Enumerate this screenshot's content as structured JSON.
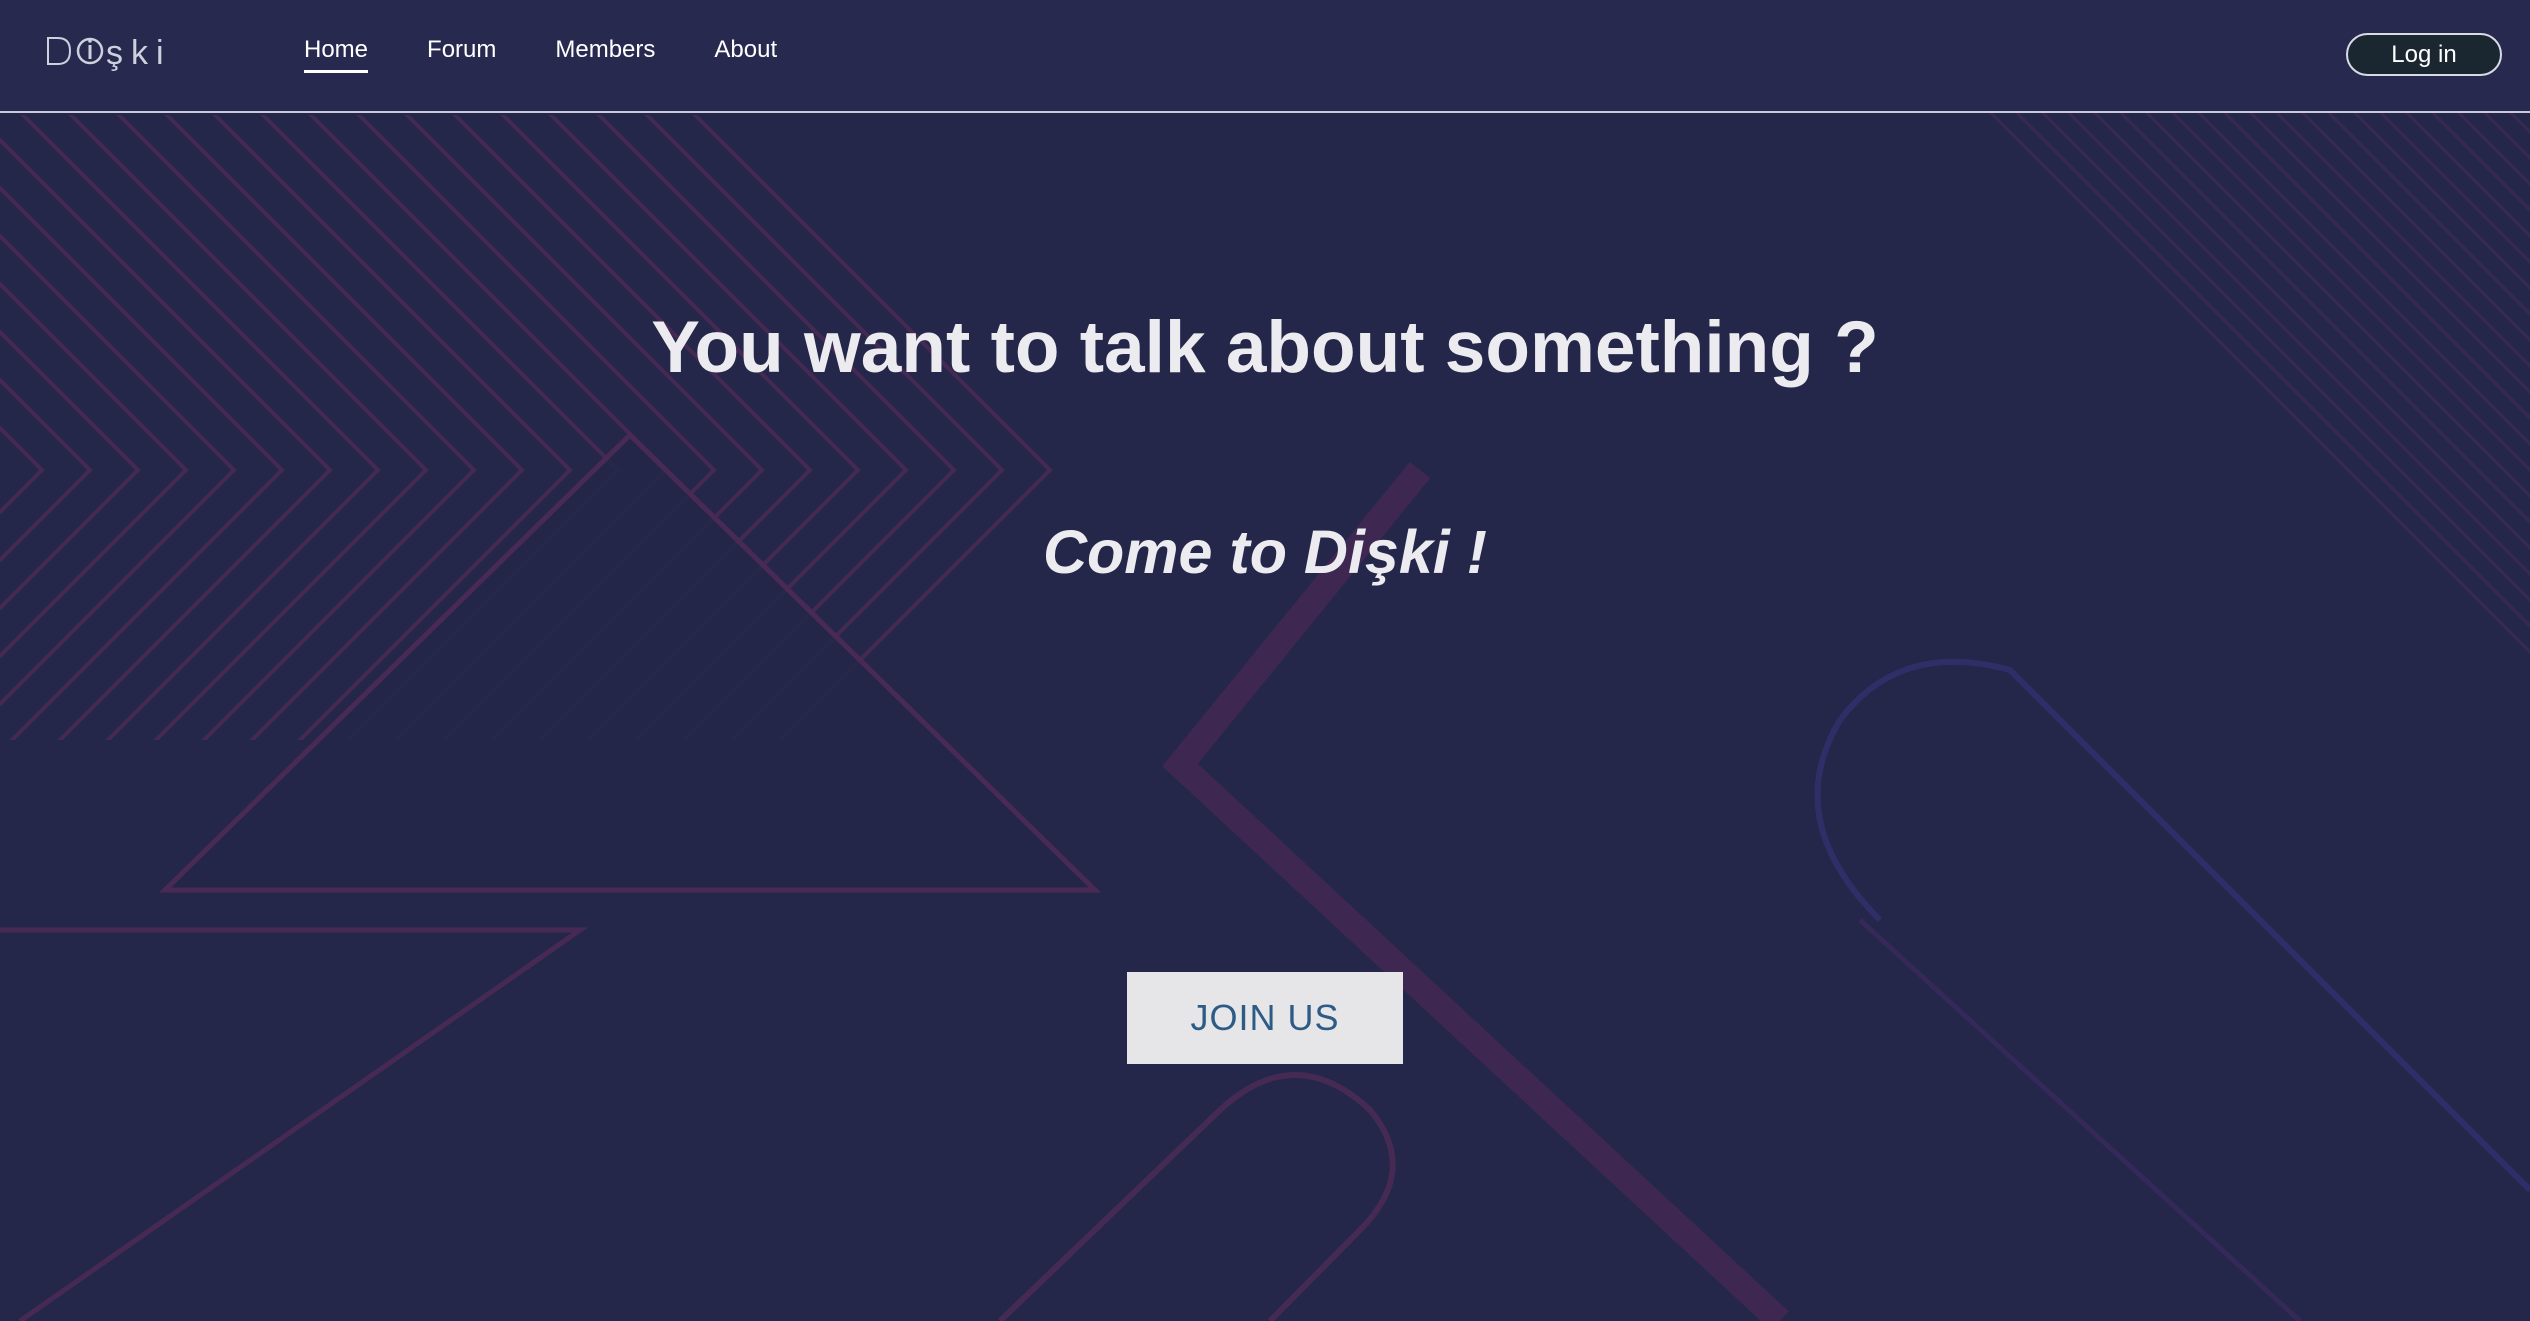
{
  "nav": {
    "logo_text": "Dişki",
    "links": [
      {
        "label": "Home",
        "active": true
      },
      {
        "label": "Forum",
        "active": false
      },
      {
        "label": "Members",
        "active": false
      },
      {
        "label": "About",
        "active": false
      }
    ],
    "login_label": "Log in"
  },
  "hero": {
    "title": "You want to talk about something ?",
    "subtitle": "Come to Dişki !",
    "cta_label": "JOIN US"
  },
  "colors": {
    "background": "#24264a",
    "navbar": "#28294f",
    "accent_lines": "#5a2f5a",
    "cta_background": "#e6e6e8",
    "cta_text": "#2d5b86",
    "login_background": "#1a2731"
  },
  "icons": {
    "logo": "diski-logo-mark"
  }
}
